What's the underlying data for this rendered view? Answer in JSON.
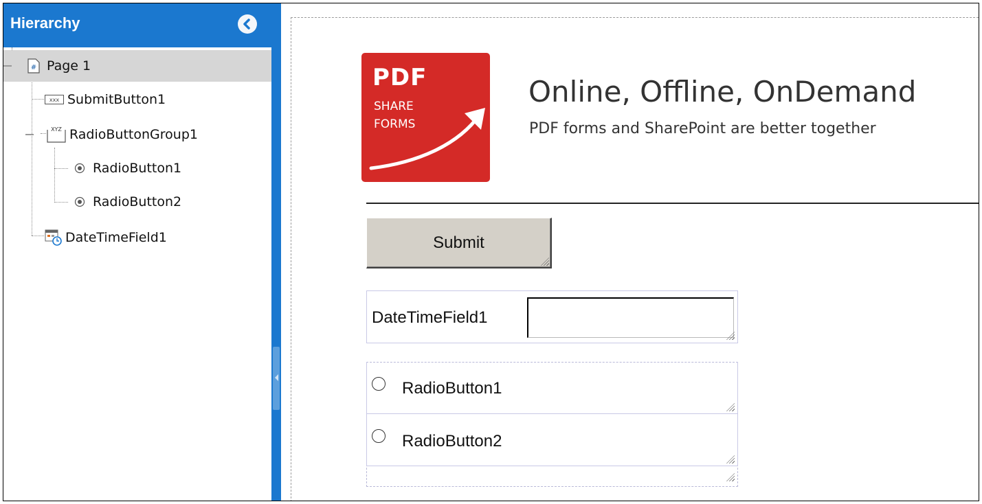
{
  "hierarchy": {
    "title": "Hierarchy",
    "items": [
      {
        "label": "Page 1",
        "icon": "page-icon"
      },
      {
        "label": "SubmitButton1",
        "icon": "button-field-icon"
      },
      {
        "label": "RadioButtonGroup1",
        "icon": "group-field-icon"
      },
      {
        "label": "RadioButton1",
        "icon": "radio-icon"
      },
      {
        "label": "RadioButton2",
        "icon": "radio-icon"
      },
      {
        "label": "DateTimeField1",
        "icon": "datetime-icon"
      }
    ],
    "button_icon_text": "xxx",
    "group_icon_text": "XYZ"
  },
  "logo": {
    "line1": "PDF",
    "line2": "SHARE",
    "line3": "FORMS"
  },
  "header": {
    "tagline": "Online, Offline, OnDemand",
    "subtagline": "PDF forms and SharePoint are better together"
  },
  "form": {
    "submit_label": "Submit",
    "datetime_label": "DateTimeField1",
    "datetime_value": "",
    "radio1_label": "RadioButton1",
    "radio2_label": "RadioButton2"
  },
  "colors": {
    "panel_header": "#1b78cf",
    "logo_red": "#d42a27",
    "selected_row": "#d6d6d6"
  }
}
